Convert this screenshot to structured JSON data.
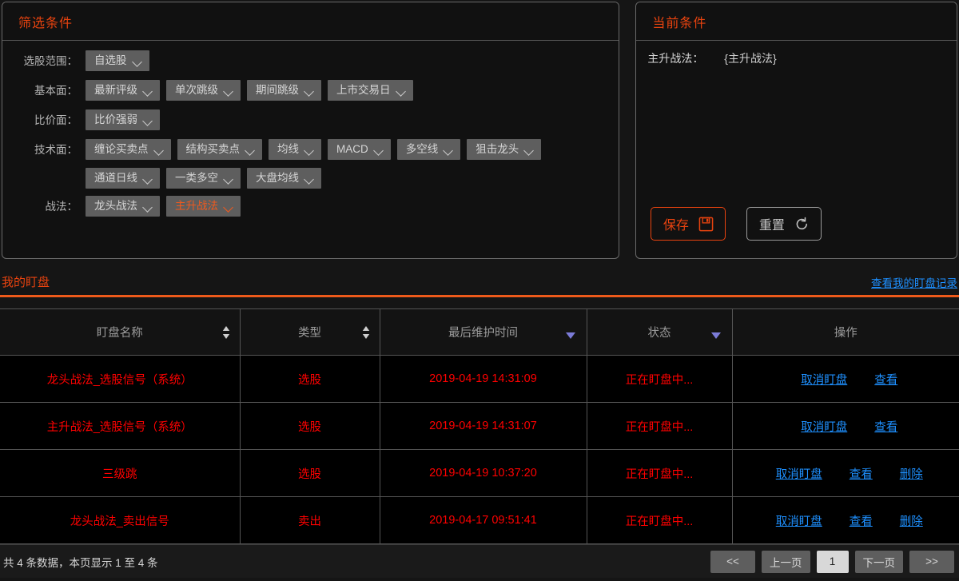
{
  "filter_panel": {
    "title": "筛选条件",
    "rows": [
      {
        "label": "选股范围：",
        "items": [
          {
            "label": "自选股",
            "active": false
          }
        ]
      },
      {
        "label": "基本面：",
        "items": [
          {
            "label": "最新评级",
            "active": false
          },
          {
            "label": "单次跳级",
            "active": false
          },
          {
            "label": "期间跳级",
            "active": false
          },
          {
            "label": "上市交易日",
            "active": false
          }
        ]
      },
      {
        "label": "比价面：",
        "items": [
          {
            "label": "比价强弱",
            "active": false
          }
        ]
      },
      {
        "label": "技术面：",
        "items": [
          {
            "label": "缠论买卖点",
            "active": false
          },
          {
            "label": "结构买卖点",
            "active": false
          },
          {
            "label": "均线",
            "active": false
          },
          {
            "label": "MACD",
            "active": false
          },
          {
            "label": "多空线",
            "active": false
          },
          {
            "label": "狙击龙头",
            "active": false
          },
          {
            "label": "通道日线",
            "active": false
          },
          {
            "label": "一类多空",
            "active": false
          },
          {
            "label": "大盘均线",
            "active": false
          }
        ]
      },
      {
        "label": "战法：",
        "items": [
          {
            "label": "龙头战法",
            "active": false
          },
          {
            "label": "主升战法",
            "active": true
          }
        ]
      }
    ]
  },
  "current_panel": {
    "title": "当前条件",
    "condition_key": "主升战法：",
    "condition_value": "{主升战法}",
    "save_label": "保存",
    "reset_label": "重置"
  },
  "section": {
    "title": "我的盯盘",
    "link": "查看我的盯盘记录"
  },
  "table": {
    "headers": [
      {
        "label": "盯盘名称",
        "icon": "sort-icon"
      },
      {
        "label": "类型",
        "icon": "sort-icon"
      },
      {
        "label": "最后维护时间",
        "icon": "filter-icon"
      },
      {
        "label": "状态",
        "icon": "filter-icon"
      },
      {
        "label": "操作",
        "icon": ""
      }
    ],
    "rows": [
      {
        "name": "龙头战法_选股信号（系统）",
        "type": "选股",
        "time": "2019-04-19 14:31:09",
        "status": "正在盯盘中...",
        "ops": [
          "取消盯盘",
          "查看"
        ]
      },
      {
        "name": "主升战法_选股信号（系统）",
        "type": "选股",
        "time": "2019-04-19 14:31:07",
        "status": "正在盯盘中...",
        "ops": [
          "取消盯盘",
          "查看"
        ]
      },
      {
        "name": "三级跳",
        "type": "选股",
        "time": "2019-04-19 10:37:20",
        "status": "正在盯盘中...",
        "ops": [
          "取消盯盘",
          "查看",
          "删除"
        ]
      },
      {
        "name": "龙头战法_卖出信号",
        "type": "卖出",
        "time": "2019-04-17 09:51:41",
        "status": "正在盯盘中...",
        "ops": [
          "取消盯盘",
          "查看",
          "删除"
        ]
      }
    ]
  },
  "footer": {
    "summary": "共 4 条数据，本页显示 1 至 4 条",
    "pager": [
      {
        "label": "<<",
        "current": false
      },
      {
        "label": "上一页",
        "current": false
      },
      {
        "label": "1",
        "current": true
      },
      {
        "label": "下一页",
        "current": false
      },
      {
        "label": ">>",
        "current": false
      }
    ]
  },
  "colors": {
    "accent": "#e8430f",
    "link": "#1e90ff",
    "row_text": "#ff0000",
    "button_bg": "#5e5e5e"
  }
}
